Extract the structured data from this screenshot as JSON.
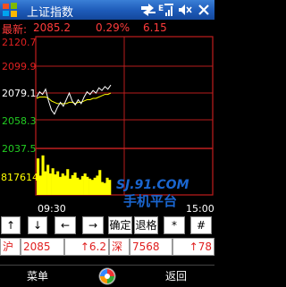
{
  "title_bar": {
    "app_title": "上证指数",
    "tray_icons": [
      "network-icon",
      "signal-icon",
      "volume-mute-icon",
      "close-icon"
    ]
  },
  "info_bar": {
    "label": "最新:",
    "price": "2085.2",
    "change_pct": "0.29%",
    "change": "6.15"
  },
  "chart": {
    "price_labels": [
      "2120.7",
      "2099.9",
      "2079.1",
      "2058.3",
      "2037.5"
    ],
    "volume_label": "817614",
    "time_labels": [
      "09:30",
      "15:00"
    ],
    "watermark_brand": "SJ.91.COM",
    "watermark_text": "手机平台",
    "colors": {
      "grid": "#b81d1d",
      "price_line": "#ffffff",
      "avg_line": "#ffff00",
      "volume": "#ffff00",
      "frame": "#e02020",
      "label_top": "#e02020",
      "label_bottom": "#22cc22"
    }
  },
  "chart_data": {
    "type": "line",
    "x_ticks": [
      "09:30",
      "15:00"
    ],
    "y_ticks": [
      "2120.7",
      "2099.9",
      "2079.1",
      "2058.3",
      "2037.5"
    ],
    "ylim": [
      2037.5,
      2120.7
    ],
    "series": [
      {
        "values": [
          2076,
          2080,
          2078,
          2082,
          2073,
          2066,
          2063,
          2068,
          2072,
          2069,
          2074,
          2079,
          2073,
          2070,
          2074,
          2071,
          2076,
          2080,
          2078,
          2081,
          2079,
          2083,
          2081,
          2084,
          2082,
          2085.2
        ]
      },
      {
        "values": [
          2075,
          2076,
          2076,
          2076,
          2075,
          2073,
          2072,
          2071,
          2071,
          2071,
          2071,
          2072,
          2072,
          2071,
          2072,
          2072,
          2073,
          2074,
          2074,
          2075,
          2075,
          2076,
          2077,
          2078,
          2078,
          2079
        ]
      }
    ],
    "volume": [
      0.85,
      0.45,
      0.92,
      0.55,
      0.7,
      0.5,
      0.62,
      0.48,
      0.55,
      0.42,
      0.5,
      0.45,
      0.6,
      0.38,
      0.46,
      0.52,
      0.4,
      0.36,
      0.44,
      0.5,
      0.42,
      0.38,
      0.35,
      0.4,
      0.45,
      0.58,
      0.3,
      0.28,
      0.4,
      0.35
    ],
    "grid": true
  },
  "buttons": {
    "up": "↑",
    "down": "↓",
    "left": "←",
    "right": "→",
    "confirm": "确定",
    "back": "退格",
    "star": "*",
    "hash": "#"
  },
  "status": {
    "market1": "沪",
    "value1": "2085",
    "change1": "↑6.2",
    "market2": "深",
    "value2": "7568",
    "change2": "↑78"
  },
  "softkeys": {
    "left": "菜单",
    "right": "返回"
  }
}
